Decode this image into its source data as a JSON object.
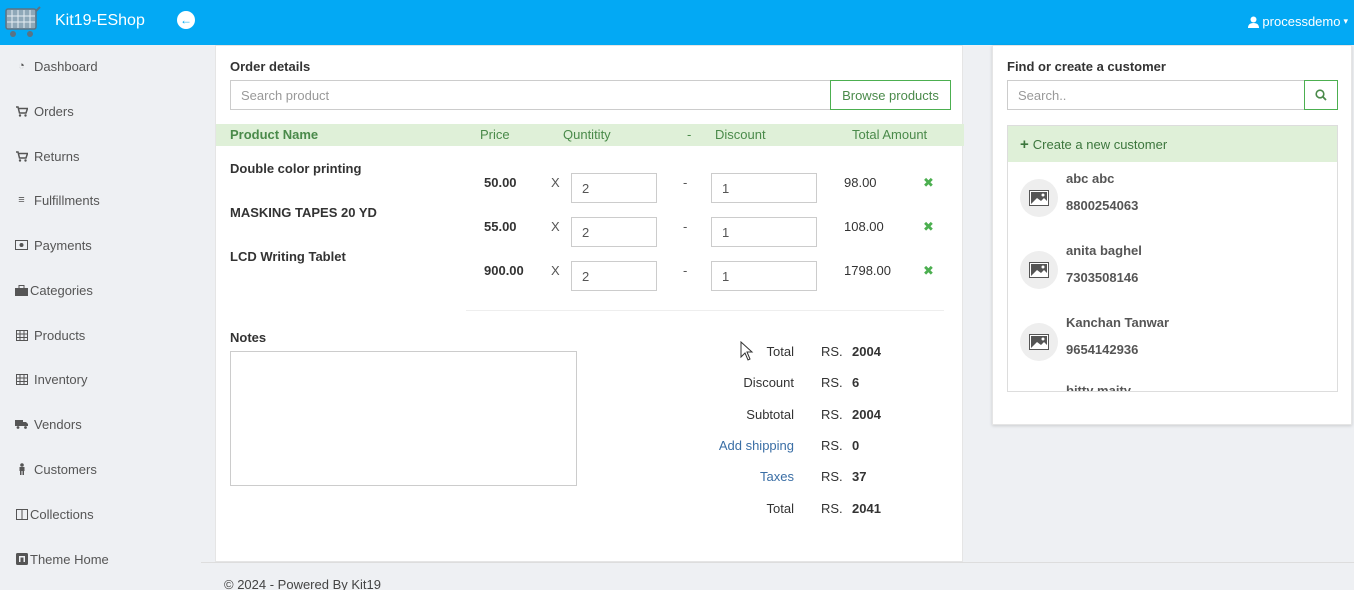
{
  "header": {
    "brand": "Kit19-EShop",
    "user": "processdemo"
  },
  "sidebar": {
    "items": [
      {
        "label": "Dashboard",
        "icon": "dashboard-icon"
      },
      {
        "label": "Orders",
        "icon": "cart-icon"
      },
      {
        "label": "Returns",
        "icon": "cart-icon"
      },
      {
        "label": "Fulfillments",
        "icon": "bars-icon"
      },
      {
        "label": "Payments",
        "icon": "money-icon"
      },
      {
        "label": "Categories",
        "icon": "briefcase-icon"
      },
      {
        "label": "Products",
        "icon": "table-icon"
      },
      {
        "label": "Inventory",
        "icon": "table-icon"
      },
      {
        "label": "Vendors",
        "icon": "truck-icon"
      },
      {
        "label": "Customers",
        "icon": "person-icon"
      },
      {
        "label": "Collections",
        "icon": "columns-icon"
      },
      {
        "label": "Theme Home",
        "icon": "home-box-icon"
      }
    ]
  },
  "order": {
    "title": "Order details",
    "search_placeholder": "Search product",
    "browse_label": "Browse products",
    "columns": {
      "name": "Product Name",
      "price": "Price",
      "quantity": "Quntitity",
      "dash": "-",
      "discount": "Discount",
      "total": "Total Amount"
    },
    "rows": [
      {
        "name": "Double color printing",
        "price": "50.00",
        "x": "X",
        "qty": "2",
        "dash": "-",
        "discount": "1",
        "total": "98.00"
      },
      {
        "name": "MASKING TAPES 20 YD",
        "price": "55.00",
        "x": "X",
        "qty": "2",
        "dash": "-",
        "discount": "1",
        "total": "108.00"
      },
      {
        "name": "LCD Writing Tablet",
        "price": "900.00",
        "x": "X",
        "qty": "2",
        "dash": "-",
        "discount": "1",
        "total": "1798.00"
      }
    ],
    "notes_label": "Notes",
    "summary": [
      {
        "label": "Total",
        "currency": "RS.",
        "value": "2004",
        "link": false
      },
      {
        "label": "Discount",
        "currency": "RS.",
        "value": "6",
        "link": false
      },
      {
        "label": "Subtotal",
        "currency": "RS.",
        "value": "2004",
        "link": false
      },
      {
        "label": "Add shipping",
        "currency": "RS.",
        "value": "0",
        "link": true
      },
      {
        "label": "Taxes",
        "currency": "RS.",
        "value": "37",
        "link": true
      },
      {
        "label": "Total",
        "currency": "RS.",
        "value": "2041",
        "link": false
      }
    ]
  },
  "customer": {
    "title": "Find or create a customer",
    "search_placeholder": "Search..",
    "create_label": "Create a new customer",
    "list": [
      {
        "name": "abc abc",
        "phone": "8800254063"
      },
      {
        "name": "anita baghel",
        "phone": "7303508146"
      },
      {
        "name": "Kanchan Tanwar",
        "phone": "9654142936"
      },
      {
        "name": "bitty maity",
        "phone": ""
      }
    ]
  },
  "footer": {
    "text": "© 2024 - Powered By Kit19"
  },
  "colors": {
    "topbar": "#03a9f4",
    "accent_green": "#4caf50",
    "header_row": "#dff0d8",
    "link": "#3a6ea5"
  }
}
